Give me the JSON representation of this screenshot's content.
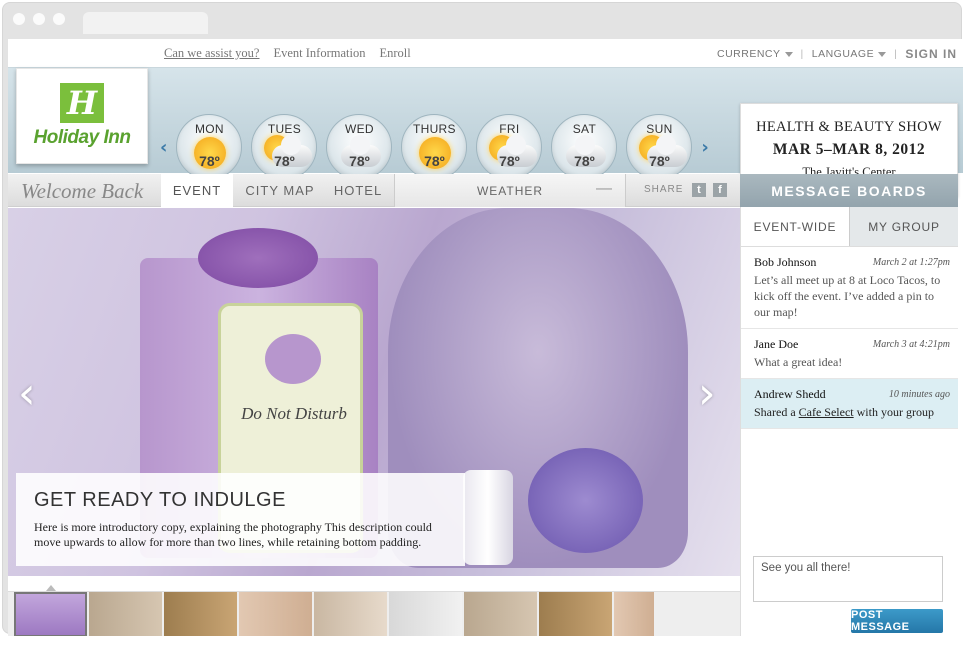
{
  "header": {
    "brand": "Holiday Inn",
    "links": [
      "Can we assist you?",
      "Event Information",
      "Enroll"
    ],
    "currency_label": "CURRENCY",
    "language_label": "LANGUAGE",
    "sign_in_label": "SIGN IN"
  },
  "weather": {
    "days": [
      {
        "day": "MON",
        "temp": "78º",
        "icon": "sun-icon"
      },
      {
        "day": "TUES",
        "temp": "78º",
        "icon": "partly-cloudy-icon"
      },
      {
        "day": "WED",
        "temp": "78º",
        "icon": "cloud-icon"
      },
      {
        "day": "THURS",
        "temp": "78º",
        "icon": "sun-icon"
      },
      {
        "day": "FRI",
        "temp": "78º",
        "icon": "partly-cloudy-icon"
      },
      {
        "day": "SAT",
        "temp": "78º",
        "icon": "cloud-icon"
      },
      {
        "day": "SUN",
        "temp": "78º",
        "icon": "partly-cloudy-icon"
      }
    ]
  },
  "event": {
    "title": "HEALTH & BEAUTY SHOW",
    "dates": "MAR 5–MAR 8, 2012",
    "venue": "The Javitt's Center"
  },
  "nav": {
    "welcome": "Welcome Back",
    "tabs": [
      "EVENT",
      "CITY MAP",
      "HOTEL"
    ],
    "weather_tab": "WEATHER",
    "share_label": "SHARE"
  },
  "hero": {
    "heading": "GET READY TO INDULGE",
    "description": "Here is more introductory copy, explaining the photography This description could move upwards to allow for more than two lines, while retaining bottom padding.",
    "product_label": "Do Not Disturb"
  },
  "message_boards": {
    "title": "MESSAGE BOARDS",
    "tabs": [
      "EVENT-WIDE",
      "MY GROUP"
    ],
    "messages": [
      {
        "author": "Bob Johnson",
        "time": "March 2 at 1:27pm",
        "text": "Let’s all meet up at 8 at Loco Tacos, to kick off the event. I’ve added a pin to our map!"
      },
      {
        "author": "Jane Doe",
        "time": "March 3 at 4:21pm",
        "text": "What a great idea!"
      },
      {
        "author": "Andrew Shedd",
        "time": "10 minutes ago",
        "text_prefix": "Shared a ",
        "link": "Cafe Select",
        "text_suffix": " with your group"
      }
    ],
    "reply_placeholder": "See you all there!",
    "post_button": "POST MESSAGE"
  },
  "colors": {
    "brand_green": "#7bbf3c",
    "accent_blue": "#2577a8",
    "header_band": "#c7d8df"
  }
}
